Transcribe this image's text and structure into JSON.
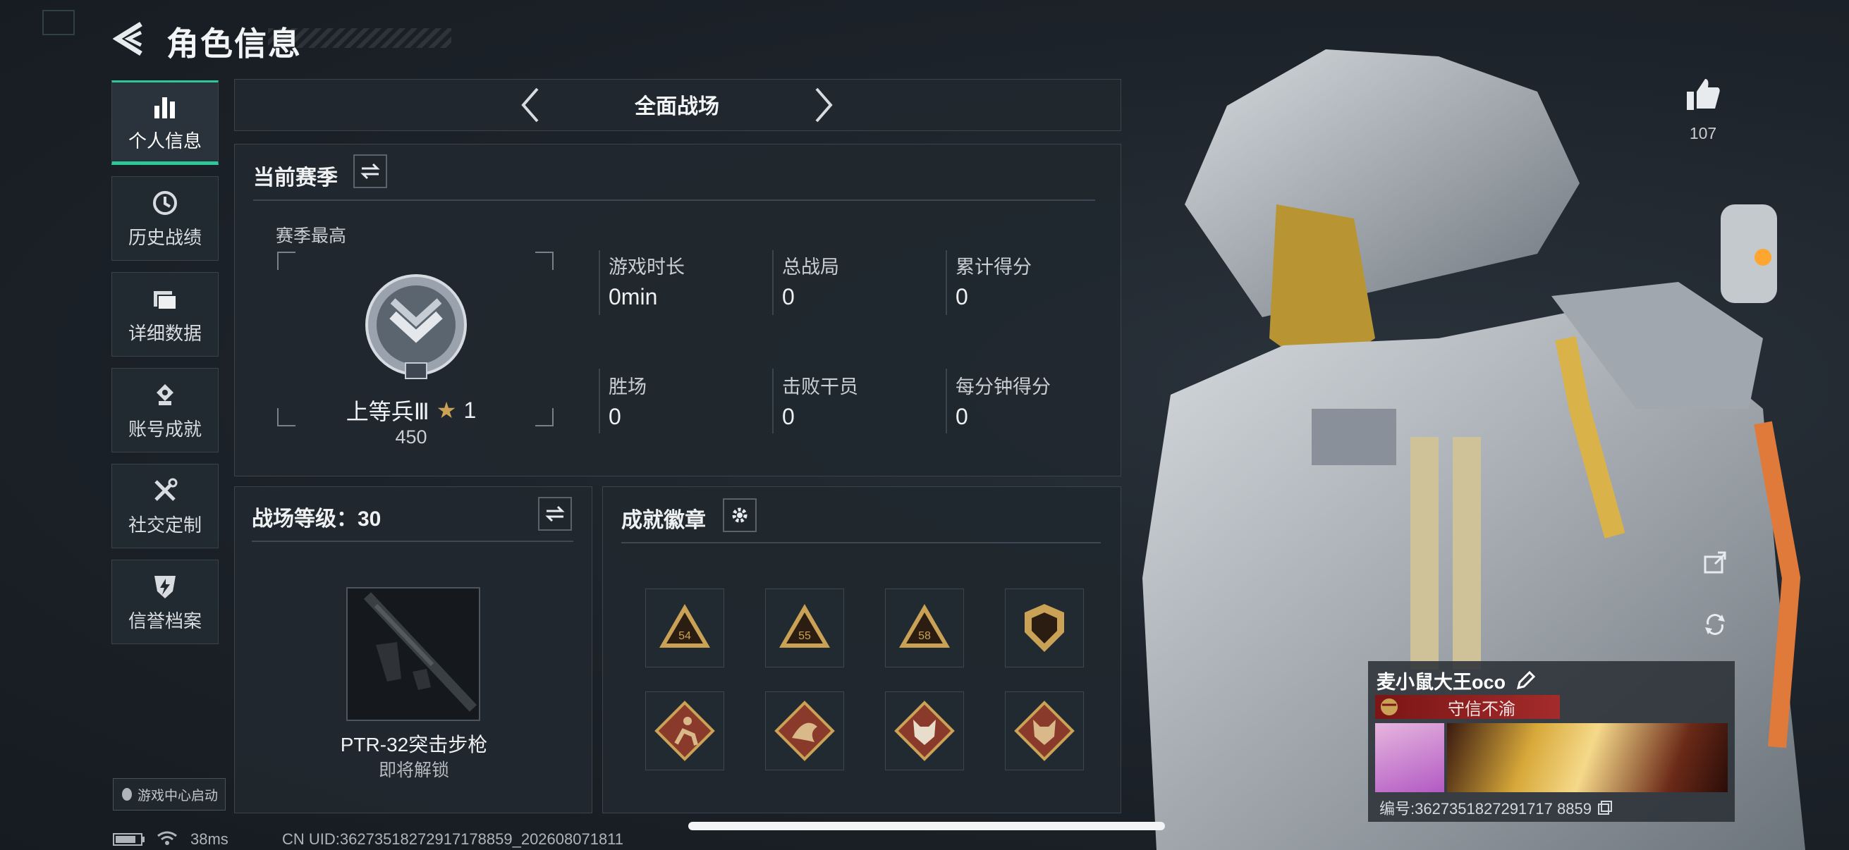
{
  "header": {
    "title": "角色信息"
  },
  "nav": {
    "items": [
      {
        "label": "个人信息",
        "icon": "bar-chart-icon",
        "active": true
      },
      {
        "label": "历史战绩",
        "icon": "history-icon"
      },
      {
        "label": "详细数据",
        "icon": "folder-icon"
      },
      {
        "label": "账号成就",
        "icon": "achievement-icon"
      },
      {
        "label": "社交定制",
        "icon": "tools-icon"
      },
      {
        "label": "信誉档案",
        "icon": "shield-bolt-icon"
      }
    ]
  },
  "mode": {
    "label": "全面战场"
  },
  "season": {
    "title": "当前赛季",
    "best_label": "赛季最高",
    "rank_name": "上等兵Ⅲ",
    "rank_stars": "1",
    "rank_points": "450",
    "stats": [
      {
        "label": "游戏时长",
        "value": "0min"
      },
      {
        "label": "总战局",
        "value": "0"
      },
      {
        "label": "累计得分",
        "value": "0"
      },
      {
        "label": "胜场",
        "value": "0"
      },
      {
        "label": "击败干员",
        "value": "0"
      },
      {
        "label": "每分钟得分",
        "value": "0"
      }
    ]
  },
  "battle_level": {
    "title": "战场等级：30",
    "weapon_name": "PTR-32突击步枪",
    "weapon_status": "即将解锁"
  },
  "badges": {
    "title": "成就徽章",
    "items": [
      {
        "icon": "badge-54-icon",
        "num": "54"
      },
      {
        "icon": "badge-55-icon",
        "num": "55"
      },
      {
        "icon": "badge-58-icon",
        "num": "58"
      },
      {
        "icon": "badge-shield-icon",
        "num": ""
      },
      {
        "icon": "badge-runner-icon",
        "num": ""
      },
      {
        "icon": "badge-dragon-icon",
        "num": ""
      },
      {
        "icon": "badge-wolf-icon",
        "num": ""
      },
      {
        "icon": "badge-wolf2-icon",
        "num": ""
      }
    ]
  },
  "likes": {
    "count": "107"
  },
  "player": {
    "name": "麦小鼠大王oco",
    "title": "守信不渝",
    "id_text": "编号:3627351827291717 8859"
  },
  "footer": {
    "game_center": "游戏中心启动",
    "ping": "38ms",
    "uid": "CN UID:36273518272917178859_202608071811"
  },
  "colors": {
    "accent": "#2dc79a",
    "gold": "#c9a256",
    "title_banner": "#8e1f1f"
  }
}
